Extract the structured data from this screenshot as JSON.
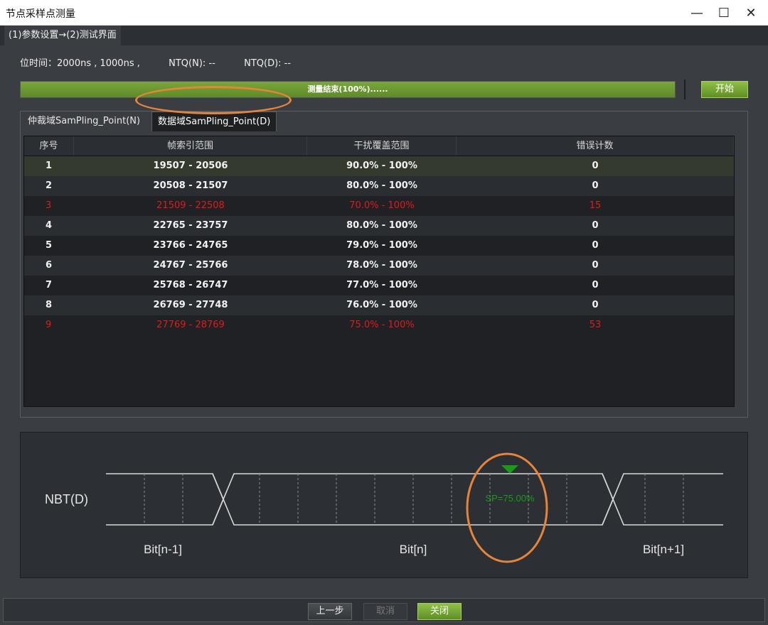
{
  "window": {
    "title": "节点采样点测量",
    "minimize": "—",
    "maximize": "☐",
    "close": "✕"
  },
  "breadcrumb": "(1)参数设置→(2)测试界面",
  "info": {
    "bit_time": "位时间：2000ns , 1000ns ,",
    "ntq_n": "NTQ(N): --",
    "ntq_d": "NTQ(D): --"
  },
  "progress": {
    "text": "测量结束(100%)......",
    "value": 1.0,
    "color": "#6e9d33"
  },
  "start_button": "开始",
  "tabs": [
    {
      "label": "仲裁域SamPling_Point(N)"
    },
    {
      "label": "数据域SamPling_Point(D)"
    }
  ],
  "table": {
    "headers": [
      "序号",
      "帧索引范围",
      "干扰覆盖范围",
      "错误计数"
    ],
    "rows": [
      {
        "cells": [
          "1",
          "19507 - 20506",
          "90.0% - 100%",
          "0"
        ],
        "error": false
      },
      {
        "cells": [
          "2",
          "20508 - 21507",
          "80.0% - 100%",
          "0"
        ],
        "error": false
      },
      {
        "cells": [
          "3",
          "21509 - 22508",
          "70.0% - 100%",
          "15"
        ],
        "error": true
      },
      {
        "cells": [
          "4",
          "22765 - 23757",
          "80.0% - 100%",
          "0"
        ],
        "error": false
      },
      {
        "cells": [
          "5",
          "23766 - 24765",
          "79.0% - 100%",
          "0"
        ],
        "error": false
      },
      {
        "cells": [
          "6",
          "24767 - 25766",
          "78.0% - 100%",
          "0"
        ],
        "error": false
      },
      {
        "cells": [
          "7",
          "25768 - 26747",
          "77.0% - 100%",
          "0"
        ],
        "error": false
      },
      {
        "cells": [
          "8",
          "26769 - 27748",
          "76.0% - 100%",
          "0"
        ],
        "error": false
      },
      {
        "cells": [
          "9",
          "27769 - 28769",
          "75.0% - 100%",
          "53"
        ],
        "error": true
      }
    ]
  },
  "waveform": {
    "signal_label": "NBT(D)",
    "sp_label": "SP=75.00%",
    "sample_point": 0.75,
    "bit_labels": [
      "Bit[n-1]",
      "Bit[n]",
      "Bit[n+1]"
    ],
    "marker_color": "#1a9a1a",
    "highlight_color": "#e8843a"
  },
  "footer": {
    "prev": "上一步",
    "cancel": "取消",
    "close": "关闭"
  },
  "colors": {
    "accent_green": "#7aad3a",
    "error_red": "#e01b1b",
    "background": "#3a3d41"
  }
}
